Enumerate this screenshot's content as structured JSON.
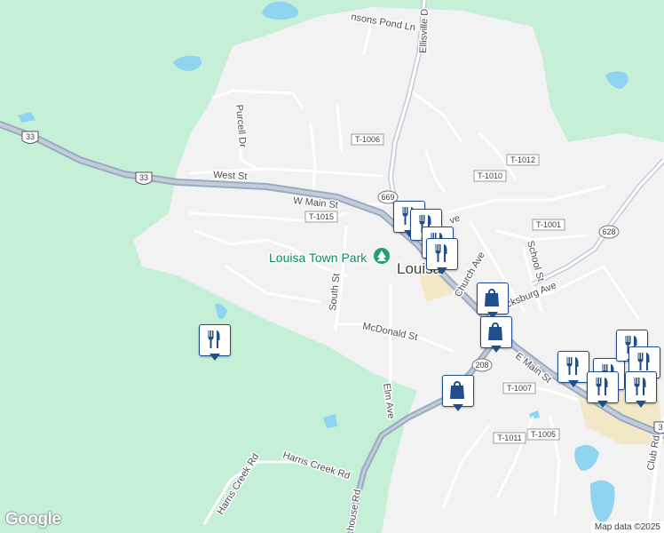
{
  "map": {
    "colors": {
      "land": "#f2f2f2",
      "forest": "#c6efd7",
      "water": "#8fd4f0",
      "road": "#ffffff",
      "highway": "#9aabc0",
      "commercial": "#f2e8c8",
      "pin_border": "#1f4e8a",
      "pin_icon": "#1f4e8a"
    },
    "labels": {
      "w_main_st": "W Main St",
      "west_st": "West St",
      "purcell_dr": "Purcell Dr",
      "ellisville_dr": "Ellisville D",
      "johnsons_pond_ln": "nsons Pond Ln",
      "south_st": "South St",
      "mcdonald_st": "McDonald St",
      "elm_ave": "Elm Ave",
      "church_ave": "Church Ave",
      "school_st": "School St",
      "fredericksburg_ave": "cksburg Ave",
      "e_main_st": "E Main St",
      "harris_creek_rd_1": "Harris Creek Rd",
      "harris_creek_rd_2": "Harris Creek Rd",
      "courthouse_rd": "house Rd",
      "club_rd": "Club Rd",
      "ave_partial": "ve",
      "town_park": "Louisa Town Park",
      "town": "Louisa"
    },
    "shields": {
      "us33_west": "33",
      "us33_mid": "33",
      "rt669": "669",
      "rt628": "628",
      "rt208": "208",
      "t1006": "T-1006",
      "t1012": "T-1012",
      "t1010": "T-1010",
      "t1015": "T-1015",
      "t1001": "T-1001",
      "t1007": "T-1007",
      "t1011": "T-1011",
      "t1005": "T-1005",
      "e33": "3"
    },
    "pins": [
      {
        "type": "restaurant",
        "icon": "fork-knife-icon"
      },
      {
        "type": "restaurant",
        "icon": "fork-knife-icon"
      },
      {
        "type": "restaurant",
        "icon": "fork-knife-icon"
      },
      {
        "type": "restaurant",
        "icon": "fork-knife-icon"
      },
      {
        "type": "shopping",
        "icon": "shopping-bag-icon"
      },
      {
        "type": "shopping",
        "icon": "shopping-bag-icon"
      },
      {
        "type": "shopping",
        "icon": "shopping-bag-icon"
      },
      {
        "type": "restaurant",
        "icon": "fork-knife-icon"
      },
      {
        "type": "restaurant",
        "icon": "fork-knife-icon"
      },
      {
        "type": "restaurant",
        "icon": "fork-knife-icon"
      },
      {
        "type": "restaurant",
        "icon": "fork-knife-icon"
      },
      {
        "type": "restaurant",
        "icon": "fork-knife-icon"
      },
      {
        "type": "restaurant",
        "icon": "fork-knife-icon"
      },
      {
        "type": "restaurant",
        "icon": "fork-knife-icon"
      }
    ],
    "park_icon": "tree-icon"
  },
  "branding": {
    "logo": "Google",
    "attribution": "Map data ©2025"
  }
}
